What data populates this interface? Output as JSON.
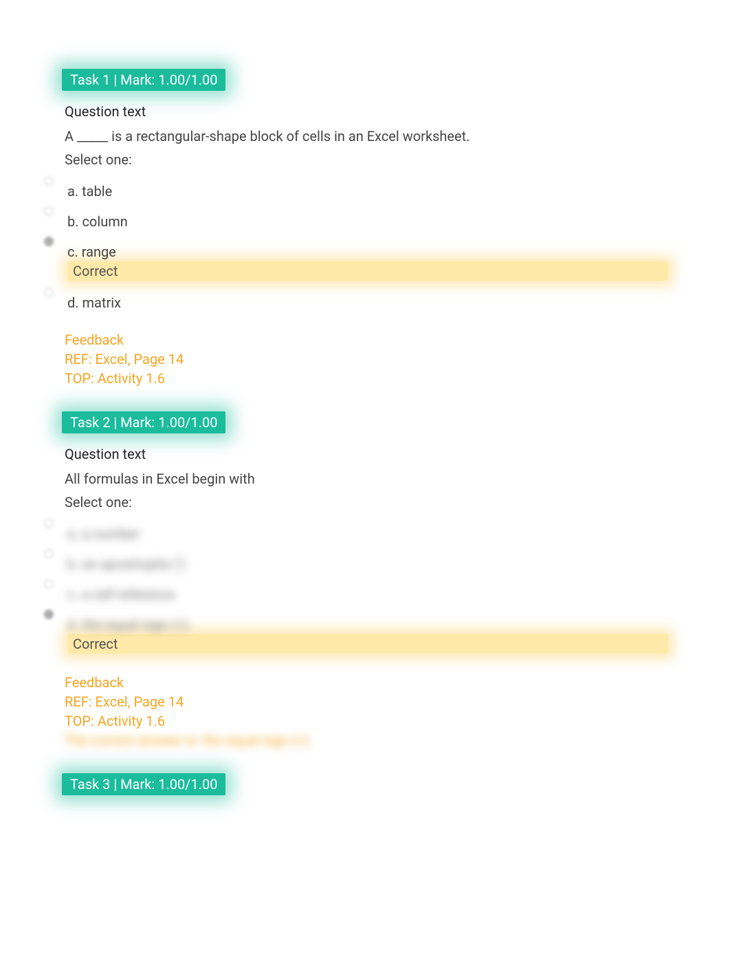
{
  "tasks": [
    {
      "header": "Task 1 | Mark: 1.00/1.00",
      "qtext_label": "Question text",
      "question": "A _____ is a rectangular-shape block of cells in an Excel worksheet.",
      "select_one": "Select one:",
      "options": [
        {
          "text": "a. table",
          "selected": false,
          "blurred": false,
          "correct": false
        },
        {
          "text": "b. column",
          "selected": false,
          "blurred": false,
          "correct": false
        },
        {
          "text": "c. range",
          "selected": true,
          "blurred": false,
          "correct": true
        },
        {
          "text": "d. matrix",
          "selected": false,
          "blurred": false,
          "correct": false
        }
      ],
      "correct_label": "Correct",
      "feedback": {
        "heading": "Feedback",
        "lines": [
          {
            "text": "REF: Excel, Page 14",
            "blurred": false
          },
          {
            "text": "TOP: Activity 1.6",
            "blurred": false
          }
        ]
      }
    },
    {
      "header": "Task 2 | Mark: 1.00/1.00",
      "qtext_label": "Question text",
      "question": "All formulas in Excel begin with",
      "select_one": "Select one:",
      "options": [
        {
          "text": "a. a number",
          "selected": false,
          "blurred": true,
          "correct": false
        },
        {
          "text": "b. an apostrophe (')",
          "selected": false,
          "blurred": true,
          "correct": false
        },
        {
          "text": "c. a cell reference",
          "selected": false,
          "blurred": true,
          "correct": false
        },
        {
          "text": "d. the equal sign (=).",
          "selected": true,
          "blurred": true,
          "correct": true
        }
      ],
      "correct_label": "Correct",
      "feedback": {
        "heading": "Feedback",
        "lines": [
          {
            "text": "REF: Excel, Page 14",
            "blurred": false
          },
          {
            "text": "TOP: Activity 1.6",
            "blurred": false
          },
          {
            "text": "The correct answer is: the equal sign (=).",
            "blurred": true
          }
        ]
      }
    },
    {
      "header": "Task 3 | Mark: 1.00/1.00"
    }
  ]
}
